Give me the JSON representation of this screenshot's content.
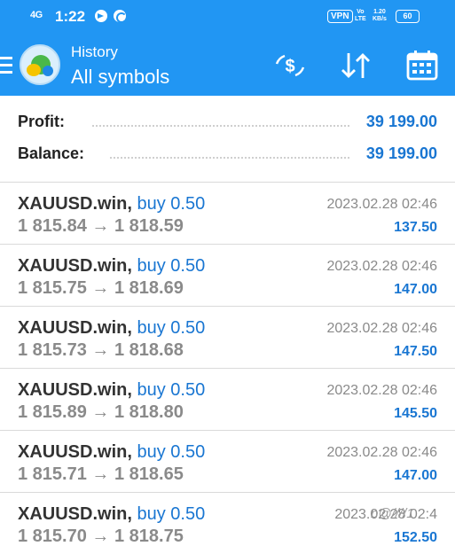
{
  "status_bar": {
    "network": "4G",
    "time": "1:22",
    "vpn": "VPN",
    "volte_top": "Vo",
    "volte_bottom": "LTE",
    "speed_value": "1.20",
    "speed_unit": "KB/s",
    "battery": "60"
  },
  "header": {
    "section": "History",
    "title": "All symbols",
    "actions": [
      "currency-exchange-icon",
      "sort-icon",
      "calendar-icon"
    ]
  },
  "summary": {
    "profit_label": "Profit:",
    "profit_value": "39 199.00",
    "balance_label": "Balance:",
    "balance_value": "39 199.00"
  },
  "trades": [
    {
      "symbol": "XAUUSD.win,",
      "side": "buy 0.50",
      "open": "1 815.84",
      "arrow": "→",
      "close": "1 818.59",
      "time": "2023.02.28 02:46",
      "profit": "137.50"
    },
    {
      "symbol": "XAUUSD.win,",
      "side": "buy 0.50",
      "open": "1 815.75",
      "arrow": "→",
      "close": "1 818.69",
      "time": "2023.02.28 02:46",
      "profit": "147.00"
    },
    {
      "symbol": "XAUUSD.win,",
      "side": "buy 0.50",
      "open": "1 815.73",
      "arrow": "→",
      "close": "1 818.68",
      "time": "2023.02.28 02:46",
      "profit": "147.50"
    },
    {
      "symbol": "XAUUSD.win,",
      "side": "buy 0.50",
      "open": "1 815.89",
      "arrow": "→",
      "close": "1 818.80",
      "time": "2023.02.28 02:46",
      "profit": "145.50"
    },
    {
      "symbol": "XAUUSD.win,",
      "side": "buy 0.50",
      "open": "1 815.71",
      "arrow": "→",
      "close": "1 818.65",
      "time": "2023.02.28 02:46",
      "profit": "147.00"
    },
    {
      "symbol": "XAUUSD.win,",
      "side": "buy 0.50",
      "open": "1 815.70",
      "arrow": "→",
      "close": "1 818.75",
      "time": "2023.02.28 02:4",
      "profit": "152.50"
    }
  ],
  "watermark": "ɒ@////1",
  "colors": {
    "header": "#2196f3",
    "accent": "#1976d2",
    "muted": "#8a8a8a"
  }
}
